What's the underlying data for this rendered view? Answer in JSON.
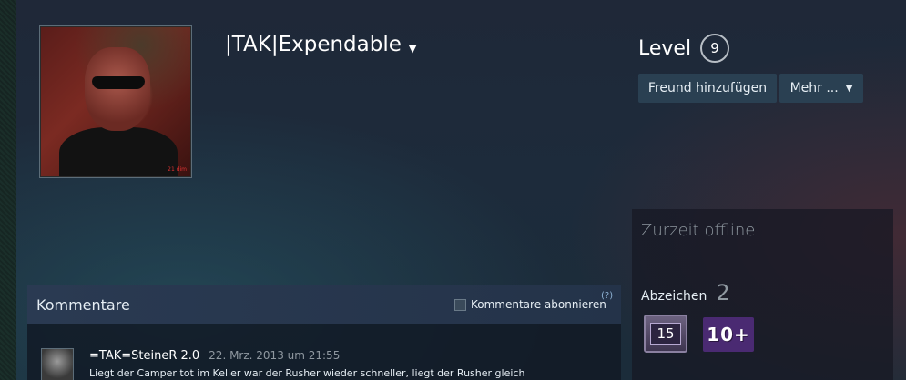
{
  "profile": {
    "persona_name": "|TAK|Expendable",
    "level_label": "Level",
    "level_value": "9",
    "avatar_mark": "21 dim"
  },
  "actions": {
    "add_friend": "Freund hinzufügen",
    "more": "Mehr ..."
  },
  "sidebar": {
    "status": "Zurzeit offline",
    "badges_label": "Abzeichen",
    "badges_count": "2",
    "badges": [
      {
        "icon": "years-of-service-badge",
        "text": "15"
      },
      {
        "icon": "game-collector-badge",
        "text": "10+"
      }
    ]
  },
  "comments": {
    "title": "Kommentare",
    "subscribe_label": "Kommentare abonnieren",
    "help": "(?)",
    "items": [
      {
        "author": "=TAK=SteineR 2.0",
        "timestamp": "22. Mrz. 2013 um 21:55",
        "text": "Liegt der Camper tot im Keller war der Rusher wieder schneller, liegt der Rusher gleich"
      }
    ]
  },
  "colors": {
    "button_bg": "#2a4052",
    "badge_purple": "#4a2a72",
    "status_gray": "#8f98a0"
  }
}
